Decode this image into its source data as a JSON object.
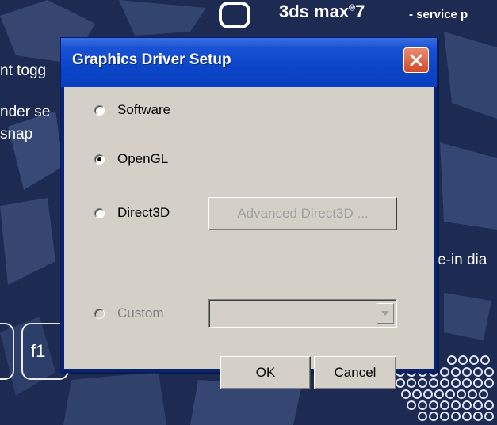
{
  "background": {
    "logo_text": "3ds max",
    "logo_sup": "®",
    "logo_version": "7",
    "logo_sub": "- service p",
    "fragments": [
      "nt togg",
      "nder se",
      " snap",
      "e-in dia",
      "f1"
    ]
  },
  "dialog": {
    "title": "Graphics Driver Setup",
    "options": [
      {
        "label": "Software",
        "checked": false,
        "disabled": false
      },
      {
        "label": "OpenGL",
        "checked": true,
        "disabled": false
      },
      {
        "label": "Direct3D",
        "checked": false,
        "disabled": false
      },
      {
        "label": "Custom",
        "checked": false,
        "disabled": true
      }
    ],
    "advanced_button_label": "Advanced Direct3D ...",
    "custom_select_value": "",
    "ok_label": "OK",
    "cancel_label": "Cancel"
  },
  "colors": {
    "titlebar": "#0b45c8",
    "client": "#d4d0c8",
    "close_button": "#d24b2a",
    "background": "#1d2a52"
  }
}
